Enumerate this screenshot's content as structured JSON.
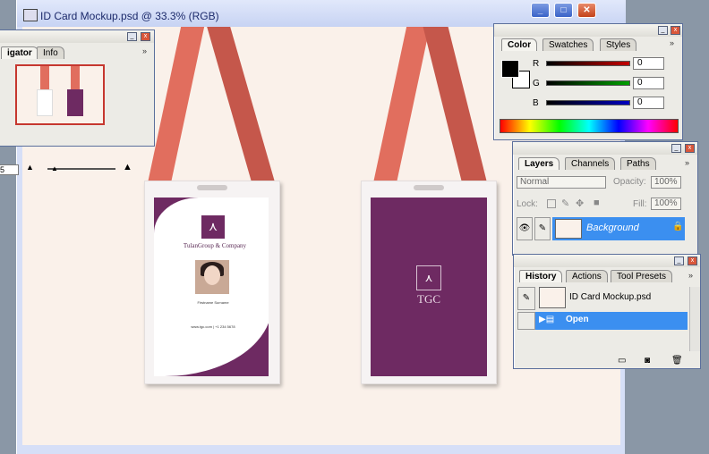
{
  "document": {
    "title": "ID Card Mockup.psd @ 33.3% (RGB)",
    "controls": {
      "minimize": "_",
      "maximize": "□",
      "close": "✕"
    }
  },
  "card_front": {
    "company": "TulanGroup & Company",
    "person_name": "Firstname Surname",
    "contact": "www.tgc.com  |  +1 234 5678"
  },
  "card_back": {
    "logo_text": "TGC"
  },
  "navigator": {
    "tabs": [
      "Navigator",
      "Info"
    ],
    "tab_visible_fragment": "igator",
    "zoom_value": "5",
    "flyout": "»"
  },
  "color_panel": {
    "tabs": [
      "Color",
      "Swatches",
      "Styles"
    ],
    "channels": [
      {
        "label": "R",
        "value": "0"
      },
      {
        "label": "G",
        "value": "0"
      },
      {
        "label": "B",
        "value": "0"
      }
    ],
    "colors": {
      "red": "#c40000",
      "green": "#00a000",
      "blue": "#0000c0"
    }
  },
  "layers_panel": {
    "tabs": [
      "Layers",
      "Channels",
      "Paths"
    ],
    "blend_mode": "Normal",
    "opacity_label": "Opacity:",
    "opacity_value": "100%",
    "lock_label": "Lock:",
    "fill_label": "Fill:",
    "fill_value": "100%",
    "layer_name": "Background"
  },
  "history_panel": {
    "tabs": [
      "History",
      "Actions",
      "Tool Presets"
    ],
    "snapshot_name": "ID Card Mockup.psd",
    "state_name": "Open"
  },
  "accent_colors": {
    "purple": "#6e2a62",
    "lanyard": "#e16e5e",
    "selection": "#3b8ff0"
  }
}
